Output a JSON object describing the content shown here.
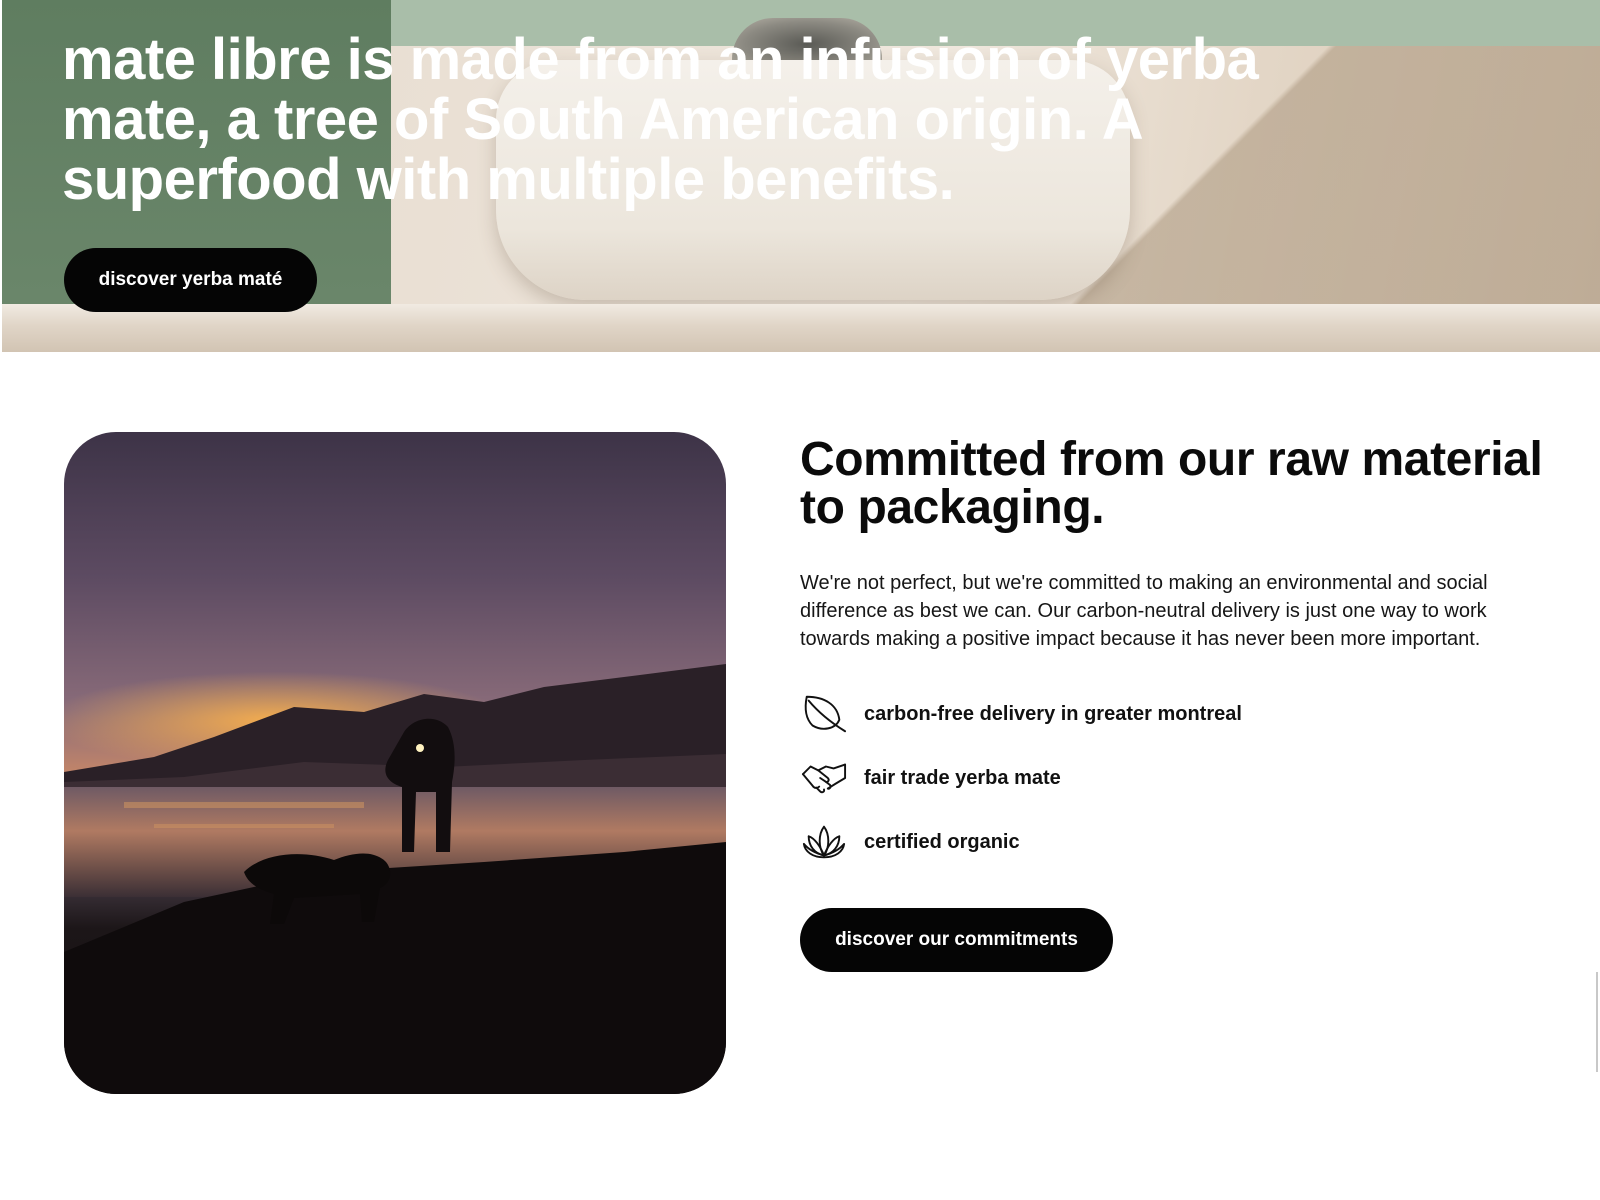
{
  "hero": {
    "title": "mate libre is made from an infusion of yerba mate, a tree of South American origin. A superfood with multiple benefits.",
    "button_label": "discover yerba maté"
  },
  "commitments": {
    "title": "Committed from our raw material to packaging.",
    "body": "We're not perfect, but we're committed to making an environmental and social difference as best we can. Our carbon-neutral delivery is just one way to work towards making a positive impact because it has never been more important.",
    "features": [
      {
        "icon": "leaf-icon",
        "label": "carbon-free delivery in greater montreal"
      },
      {
        "icon": "handshake-icon",
        "label": "fair trade yerba mate"
      },
      {
        "icon": "lotus-icon",
        "label": "certified organic"
      }
    ],
    "button_label": "discover our commitments"
  },
  "colors": {
    "button_bg": "#050505",
    "button_text": "#ffffff",
    "hero_green": "#5f7d60",
    "text": "#111111"
  }
}
